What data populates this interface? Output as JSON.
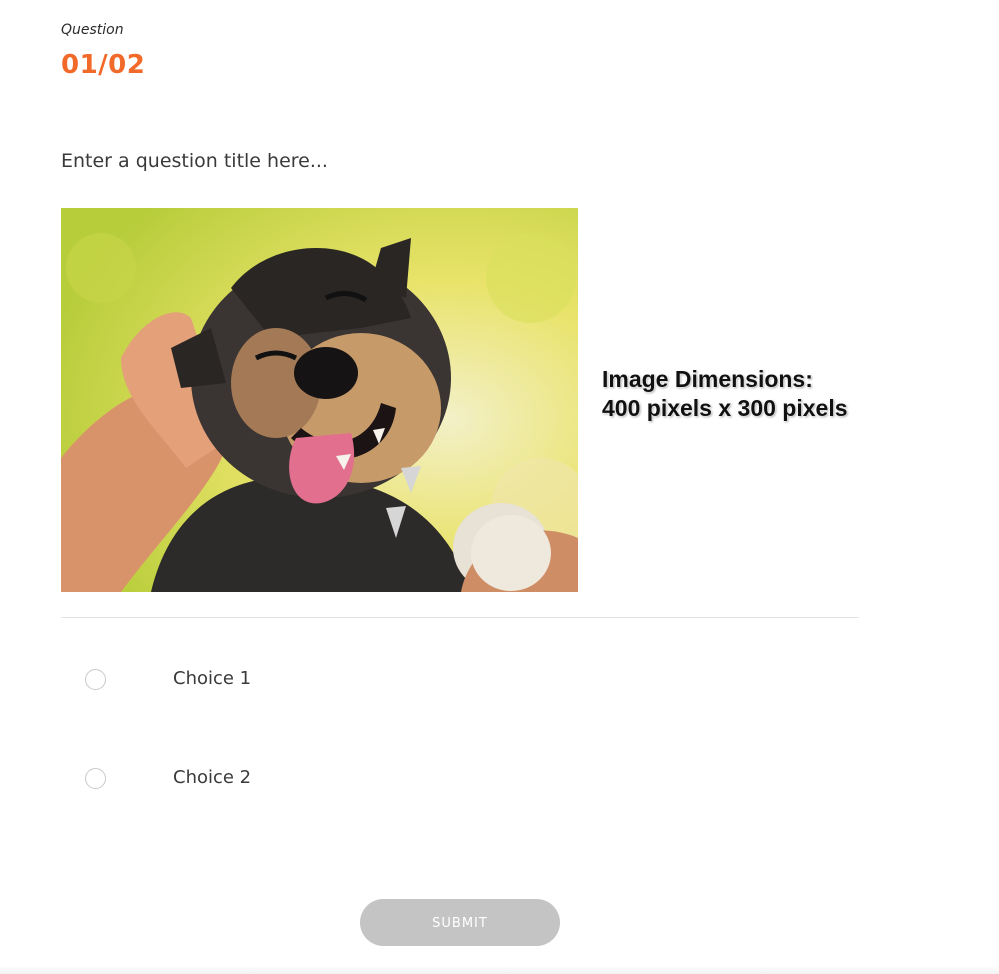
{
  "question": {
    "label": "Question",
    "counter": "01/02",
    "title_placeholder": "Enter a question title here...",
    "image_note_line1": "Image Dimensions:",
    "image_note_line2": "400 pixels x 300 pixels"
  },
  "choices": [
    {
      "label": "Choice 1"
    },
    {
      "label": "Choice 2"
    }
  ],
  "submit": {
    "label": "SUBMIT"
  },
  "colors": {
    "accent": "#f26a2a",
    "submit_background": "#c4c4c4",
    "divider": "#e3e3e3"
  }
}
